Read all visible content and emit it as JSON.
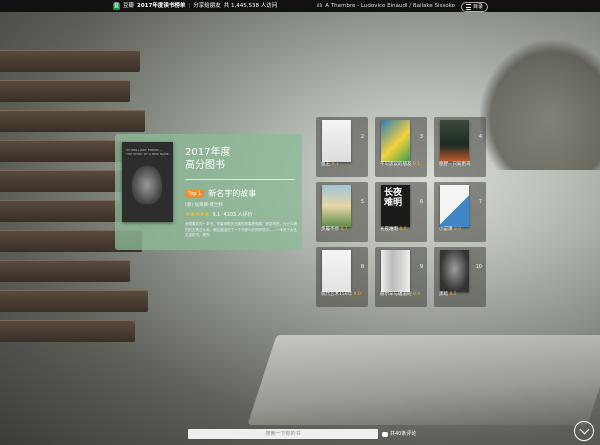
{
  "topbar": {
    "site": "豆瓣",
    "page_title": "2017年度读书榜单",
    "share": "分享给朋友",
    "visits": "共 1,445,538 人访问",
    "music": "A Thembre - Ludovico Einaudi / Ballake Sissoko",
    "catalog": "目录"
  },
  "featured": {
    "year": "2017年度",
    "category": "高分图书",
    "rank": "Top 1",
    "title": "新名字的故事",
    "author": "[意] 埃莱娜·费兰特",
    "rating": "9.1",
    "rating_count": "4103 人评价",
    "description": "我很喜欢的一本书。作者用很多元素的故事把莉娜，而描写的，为什么她们的友情这么深，莉拉被困在了一个不那么好的环境中……一本关于女性友谊的书，是的"
  },
  "books": [
    {
      "num": "2",
      "title": "鱼王",
      "score": "9.1"
    },
    {
      "num": "3",
      "title": "不可思议的朋友",
      "score": "9.1"
    },
    {
      "num": "4",
      "title": "原野—只知更鸟",
      "score": ""
    },
    {
      "num": "5",
      "title": "步履不停",
      "score": "8.7"
    },
    {
      "num": "6",
      "title": "长夜难明",
      "score": "8.6"
    },
    {
      "num": "7",
      "title": "小说课",
      "score": "8.8"
    },
    {
      "num": "8",
      "title": "现代艺术150年",
      "score": "9.0"
    },
    {
      "num": "9",
      "title": "赫尔辛与碾道的",
      "score": "8.9"
    },
    {
      "num": "10",
      "title": "黑暗",
      "score": "8.2"
    }
  ],
  "bottom": {
    "search_placeholder": "搜索一下你的书",
    "comment_count": "共40条评论"
  },
  "colors": {
    "card": "#8cba96",
    "rank_badge": "#f08d2c",
    "star": "#ffc11e",
    "score": "#f3b32a"
  }
}
